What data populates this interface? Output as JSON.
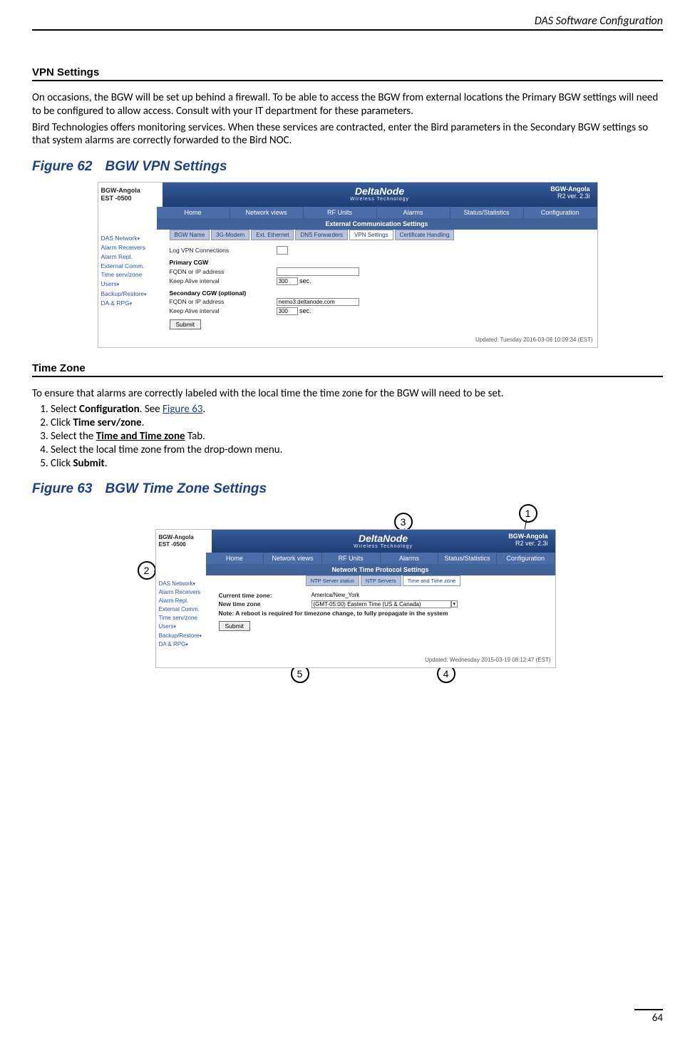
{
  "header": {
    "title": "DAS Software Configuration"
  },
  "page_number": "64",
  "section1": {
    "heading": "VPN Settings",
    "para1": "On occasions, the BGW will be set up behind a firewall. To be able to access the BGW from external locations the Primary BGW settings will need to be configured to allow access. Consult with your IT department for these parameters.",
    "para2": "Bird Technologies offers monitoring services. When these services are contracted, enter the Bird parameters in the Secondary BGW settings so that system alarms are correctly forwarded to the Bird NOC."
  },
  "figure62": {
    "number": "Figure 62",
    "title": "BGW VPN Settings",
    "host_name": "BGW-Angola",
    "host_tz": "EST -0500",
    "brand_main": "DeltaNode",
    "brand_sub": "Wireless Technology",
    "rig_name": "BGW-Angola",
    "rig_ver": "R2 ver. 2.3i",
    "mainnav": [
      "Home",
      "Network views",
      "RF Units",
      "Alarms",
      "Status/Statistics",
      "Configuration"
    ],
    "subband": "External Communication Settings",
    "sidemenu": [
      "DAS Network",
      "Alarm Receivers",
      "Alarm Repl.",
      "External Comm.",
      "Time serv/zone",
      "Users",
      "Backup/Restore",
      "DA & RPG"
    ],
    "tabs": [
      "BGW Name",
      "3G-Modem",
      "Ext. Ethernet",
      "DNS Forwarders",
      "VPN Settings",
      "Certificate Handling"
    ],
    "active_tab": "VPN Settings",
    "log_label": "Log VPN Connections",
    "primary_head": "Primary CGW",
    "fqdn_label": "FQDN or IP address",
    "keep_label": "Keep Alive interval",
    "keep_val": "300",
    "keep_unit": "sec.",
    "sec_head": "Secondary CGW (optional)",
    "sec_fqdn_val": "nemo3.deltanode.com",
    "submit": "Submit",
    "updated": "Updated: Tuesday 2016-03-08 10:09:34 (EST)"
  },
  "section2": {
    "heading": "Time Zone",
    "intro": "To ensure that alarms are correctly labeled with the local time the time zone for the BGW will need to be set.",
    "steps": {
      "s1a": "Select ",
      "s1b": "Configuration",
      "s1c": ". See ",
      "s1link": "Figure 63",
      "s1d": ".",
      "s2a": "Click ",
      "s2b": "Time serv/zone",
      "s2c": ".",
      "s3a": "Select the ",
      "s3b": "Time and Time zone",
      "s3c": " Tab.",
      "s4": "Select the local time zone from the drop-down menu.",
      "s5a": "Click ",
      "s5b": "Submit",
      "s5c": "."
    }
  },
  "figure63": {
    "number": "Figure 63",
    "title": "BGW Time Zone Settings",
    "host_name": "BGW-Angola",
    "host_tz": "EST -0500",
    "brand_main": "DeltaNode",
    "brand_sub": "Wireless Technology",
    "rig_name": "BGW-Angola",
    "rig_ver": "R2 ver. 2.3i",
    "mainnav": [
      "Home",
      "Network views",
      "RF Units",
      "Alarms",
      "Status/Statistics",
      "Configuration"
    ],
    "subband": "Network Time Protocol Settings",
    "sidemenu": [
      "DAS Network",
      "Alarm Receivers",
      "Alarm Repl.",
      "External Comm.",
      "Time serv/zone",
      "Users",
      "Backup/Restore",
      "DA & RPG"
    ],
    "tabs": [
      "NTP Server status",
      "NTP Servers",
      "Time and Time zone"
    ],
    "active_tab": "Time and Time zone",
    "curr_label": "Current time zone:",
    "curr_val": "America/New_York",
    "new_label": "New time zone",
    "new_val": "(GMT-05:00) Eastern Time (US & Canada)",
    "note": "Note: A reboot is required for timezone change, to fully propagate in the system",
    "submit": "Submit",
    "updated": "Updated: Wednesday 2015-03-19 08:12:47 (EST)",
    "callouts": {
      "c1": "1",
      "c2": "2",
      "c3": "3",
      "c4": "4",
      "c5": "5"
    }
  }
}
